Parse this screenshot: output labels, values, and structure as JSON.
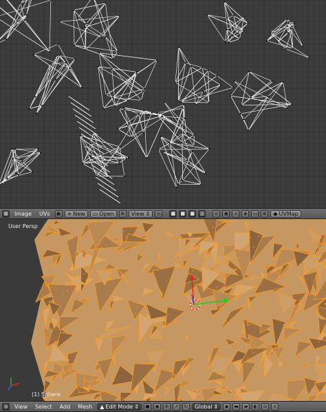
{
  "uv_editor": {
    "header": {
      "menus": [
        "Image",
        "UVs"
      ],
      "new_label": "New",
      "open_label": "Open",
      "view_label": "View",
      "uvmap_label": "UVMap"
    }
  },
  "viewport": {
    "view_label": "User Persp",
    "object_label": "(1) Sphere",
    "header": {
      "menus": [
        "View",
        "Select",
        "Add",
        "Mesh"
      ],
      "mode_label": "Edit Mode",
      "orientation_label": "Global"
    }
  },
  "colors": {
    "mesh_face": "#c69a66",
    "mesh_edge": "#ff9a1e",
    "uv_background": "#3d3d3d",
    "header": "#6a6a6a"
  },
  "icons": [
    "editor-type-icon",
    "image-browse-icon",
    "new-plus-icon",
    "open-folder-icon",
    "pin-icon",
    "pivot-icon",
    "select-mode-icon",
    "snap-icon",
    "proportional-icon",
    "sync-icon",
    "uv-sticky-icon",
    "shading-sphere-icon",
    "vertex-select-icon",
    "edge-select-icon",
    "face-select-icon",
    "manipulator-icon",
    "layer-icon"
  ]
}
